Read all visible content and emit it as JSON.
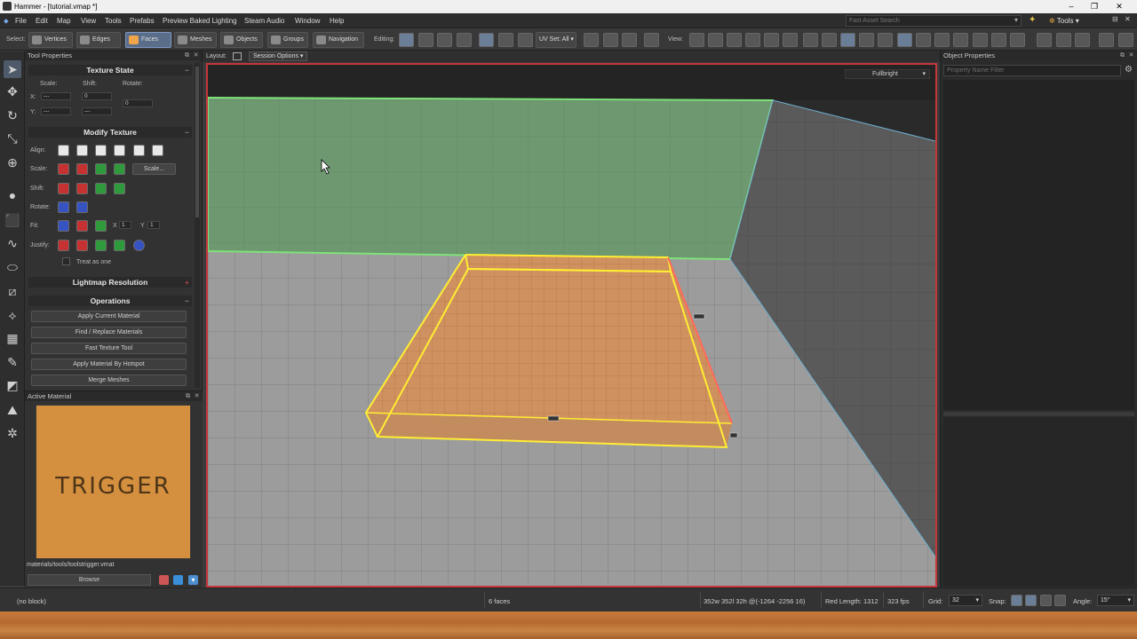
{
  "window": {
    "title": "Hammer - [tutorial.vmap *]",
    "minimize": "–",
    "maximize": "❐",
    "close": "✕"
  },
  "menu": [
    "File",
    "Edit",
    "Map",
    "View",
    "Tools",
    "Prefabs",
    "Preview Baked Lighting",
    "Steam Audio",
    "Window",
    "Help"
  ],
  "search": {
    "placeholder": "Fast Asset Search"
  },
  "tools_button": "Tools",
  "toolbar": {
    "select_label": "Select:",
    "modes": [
      "Vertices",
      "Edges",
      "Faces",
      "Meshes",
      "Objects",
      "Groups",
      "Navigation"
    ],
    "active_mode": "Faces",
    "editing_label": "Editing:",
    "uv_set": "UV Set: All",
    "view_label": "View:"
  },
  "tool_properties": {
    "title": "Tool Properties",
    "texture_state": {
      "title": "Texture State",
      "scale_label": "Scale:",
      "shift_label": "Shift:",
      "rotate_label": "Rotate:",
      "x_label": "X:",
      "y_label": "Y:",
      "scale_x": "---",
      "scale_y": "---",
      "shift_x": "0",
      "shift_y": "---",
      "rotate": "0"
    },
    "modify_texture": {
      "title": "Modify Texture",
      "align_label": "Align:",
      "scale_label": "Scale:",
      "shift_label": "Shift:",
      "rotate_label": "Rotate:",
      "fit_label": "Fit:",
      "justify_label": "Justify:",
      "scale_button": "Scale...",
      "fit_x_label": "X",
      "fit_x": "1",
      "fit_y_label": "Y",
      "fit_y": "1",
      "treat_as_one": "Treat as one"
    },
    "lightmap_resolution": {
      "title": "Lightmap Resolution"
    },
    "operations": {
      "title": "Operations",
      "buttons": [
        "Apply Current Material",
        "Find / Replace Materials",
        "Fast Texture Tool",
        "Apply Material By Hotspot",
        "Merge Meshes"
      ]
    }
  },
  "active_material": {
    "title": "Active Material",
    "swatch_text": "TRIGGER",
    "path": "materials/tools/toolstrigger.vmat",
    "browse": "Browse",
    "swatch_color": "#d48f3f"
  },
  "viewport": {
    "layout_label": "Layout:",
    "session_options": "Session Options",
    "render_mode": "Fullbright"
  },
  "object_properties": {
    "title": "Object Properties",
    "filter_placeholder": "Property Name Filter"
  },
  "status": {
    "block": "(no block)",
    "selection": "6 faces",
    "dimensions": "352w 352l 32h @(-1264 -2256 16)",
    "red_length": "Red Length: 1312",
    "fps": "323 fps",
    "grid_label": "Grid:",
    "grid": "32",
    "snap_label": "Snap:",
    "angle_label": "Angle:",
    "angle": "15°"
  },
  "colors": {
    "accent_selection": "#c6363a",
    "wall_highlight": "#7fd27a",
    "trigger_outline": "#ffee33",
    "active_mode": "#5a6e8a"
  }
}
